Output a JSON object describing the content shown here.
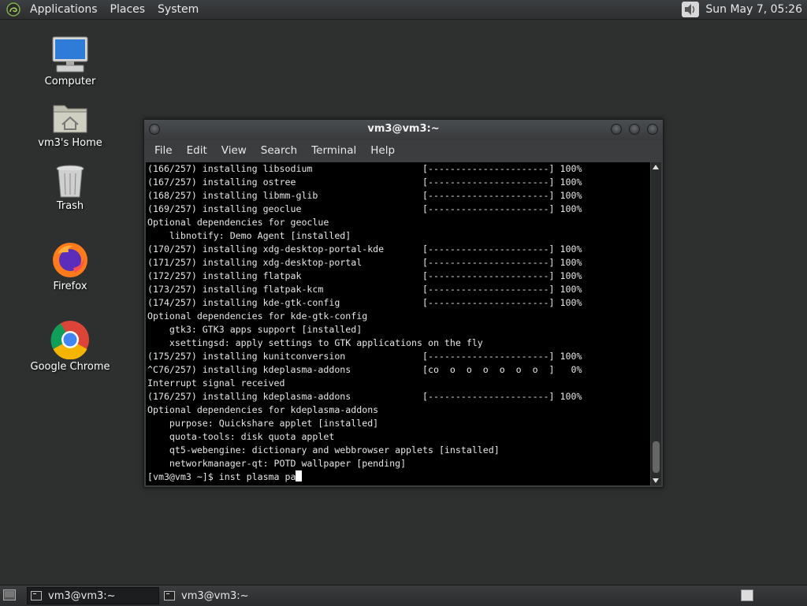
{
  "top_panel": {
    "menus": [
      "Applications",
      "Places",
      "System"
    ],
    "clock": "Sun May  7, 05:26"
  },
  "desktop": {
    "icons": [
      {
        "label": "Computer",
        "icon": "computer-icon"
      },
      {
        "label": "vm3's Home",
        "icon": "home-folder-icon"
      },
      {
        "label": "Trash",
        "icon": "trash-icon"
      },
      {
        "label": "Firefox",
        "icon": "firefox-icon"
      },
      {
        "label": "Google Chrome",
        "icon": "chrome-icon"
      }
    ]
  },
  "terminal_window": {
    "title": "vm3@vm3:~",
    "menus": [
      "File",
      "Edit",
      "View",
      "Search",
      "Terminal",
      "Help"
    ],
    "lines": [
      "(166/257) installing libsodium                    [----------------------] 100%",
      "(167/257) installing ostree                       [----------------------] 100%",
      "(168/257) installing libmm-glib                   [----------------------] 100%",
      "(169/257) installing geoclue                      [----------------------] 100%",
      "Optional dependencies for geoclue",
      "    libnotify: Demo Agent [installed]",
      "(170/257) installing xdg-desktop-portal-kde       [----------------------] 100%",
      "(171/257) installing xdg-desktop-portal           [----------------------] 100%",
      "(172/257) installing flatpak                      [----------------------] 100%",
      "(173/257) installing flatpak-kcm                  [----------------------] 100%",
      "(174/257) installing kde-gtk-config               [----------------------] 100%",
      "Optional dependencies for kde-gtk-config",
      "    gtk3: GTK3 apps support [installed]",
      "    xsettingsd: apply settings to GTK applications on the fly",
      "(175/257) installing kunitconversion              [----------------------] 100%",
      "^C76/257) installing kdeplasma-addons             [co  o  o  o  o  o  o  ]   0%",
      "Interrupt signal received",
      "(176/257) installing kdeplasma-addons             [----------------------] 100%",
      "Optional dependencies for kdeplasma-addons",
      "    purpose: Quickshare applet [installed]",
      "    quota-tools: disk quota applet",
      "    qt5-webengine: dictionary and webbrowser applets [installed]",
      "    networkmanager-qt: POTD wallpaper [pending]"
    ],
    "prompt": "[vm3@vm3 ~]$ inst plasma pa"
  },
  "taskbar": {
    "tasks": [
      {
        "label": "vm3@vm3:~",
        "active": true
      },
      {
        "label": "vm3@vm3:~",
        "active": false
      }
    ]
  }
}
